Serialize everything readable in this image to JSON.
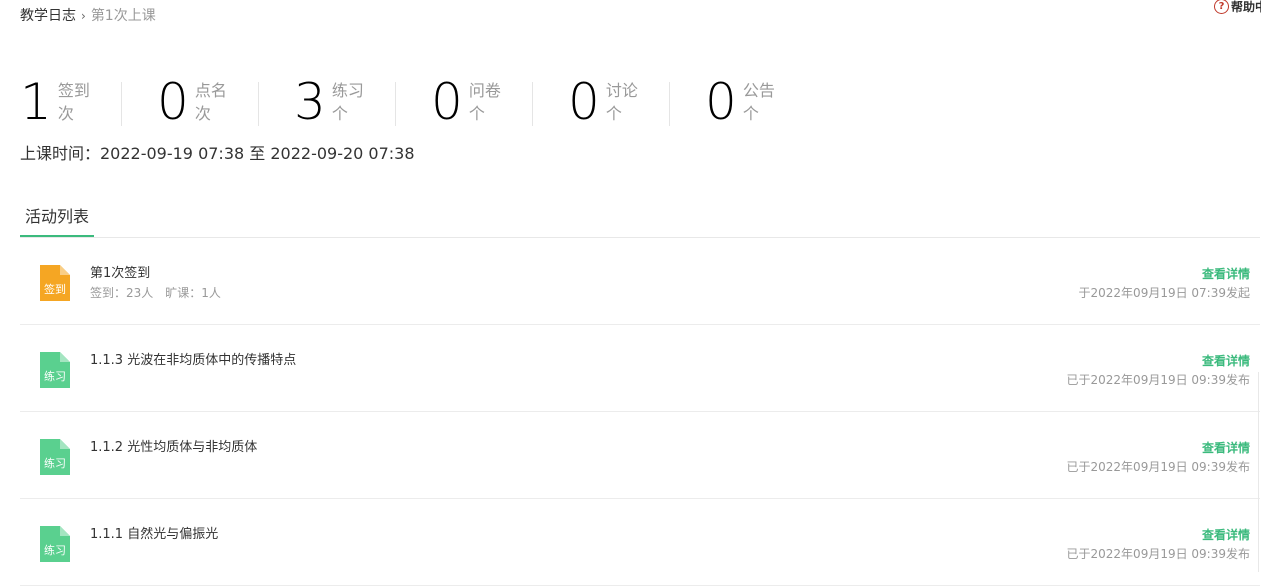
{
  "breadcrumb": {
    "home": "教学日志",
    "separator": "›",
    "current": "第1次上课"
  },
  "help": {
    "icon": "?",
    "label": "帮助中"
  },
  "stats": [
    {
      "value": "1",
      "label": "签到",
      "unit": "次"
    },
    {
      "value": "0",
      "label": "点名",
      "unit": "次"
    },
    {
      "value": "3",
      "label": "练习",
      "unit": "个"
    },
    {
      "value": "0",
      "label": "问卷",
      "unit": "个"
    },
    {
      "value": "0",
      "label": "讨论",
      "unit": "个"
    },
    {
      "value": "0",
      "label": "公告",
      "unit": "个"
    }
  ],
  "class_time": "上课时间：2022-09-19 07:38 至 2022-09-20 07:38",
  "tabs": [
    {
      "label": "活动列表",
      "active": true
    }
  ],
  "activities": [
    {
      "icon": "sign-in-file-icon",
      "icon_label": "签到",
      "color": "#f5a623",
      "title": "第1次签到",
      "sub": [
        "签到：23人",
        "旷课：1人"
      ],
      "action": "查看详情",
      "time": "于2022年09月19日 07:39发起"
    },
    {
      "icon": "exercise-file-icon",
      "icon_label": "练习",
      "color": "#5ad08f",
      "title": "1.1.3 光波在非均质体中的传播特点",
      "action": "查看详情",
      "time": "已于2022年09月19日 09:39发布"
    },
    {
      "icon": "exercise-file-icon",
      "icon_label": "练习",
      "color": "#5ad08f",
      "title": "1.1.2 光性均质体与非均质体",
      "action": "查看详情",
      "time": "已于2022年09月19日 09:39发布"
    },
    {
      "icon": "exercise-file-icon",
      "icon_label": "练习",
      "color": "#5ad08f",
      "title": "1.1.1 自然光与偏振光",
      "action": "查看详情",
      "time": "已于2022年09月19日 09:39发布"
    }
  ],
  "colors": {
    "accent": "#3bba7d",
    "sign": "#f5a623",
    "exercise": "#5ad08f"
  }
}
